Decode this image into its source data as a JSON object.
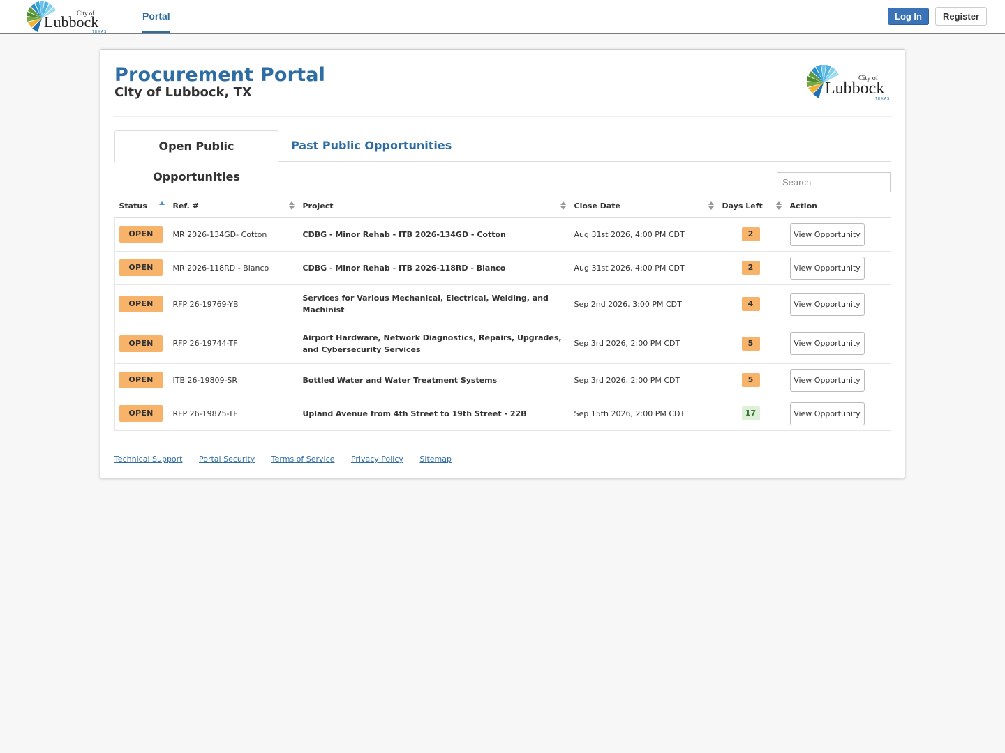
{
  "header": {
    "logo": {
      "city_of": "City of",
      "name": "Lubbock",
      "state": "TEXAS"
    },
    "nav_portal": "Portal",
    "login_label": "Log In",
    "register_label": "Register"
  },
  "page": {
    "title": "Procurement Portal",
    "subtitle": "City of Lubbock, TX"
  },
  "tabs": [
    {
      "label": "Open Public Opportunities",
      "active": true
    },
    {
      "label": "Past Public Opportunities",
      "active": false
    }
  ],
  "search": {
    "placeholder": "Search",
    "value": ""
  },
  "table": {
    "columns": [
      "Status",
      "Ref. #",
      "Project",
      "Close Date",
      "Days Left",
      "Action"
    ],
    "rows": [
      {
        "status": "OPEN",
        "ref": "MR 2026-134GD- Cotton",
        "project": "CDBG - Minor Rehab - ITB 2026-134GD - Cotton",
        "close_date": "Aug 31st 2026, 4:00 PM CDT",
        "days_left": "2",
        "action": "View Opportunity"
      },
      {
        "status": "OPEN",
        "ref": "MR 2026-118RD - Blanco",
        "project": "CDBG - Minor Rehab - ITB 2026-118RD - Blanco",
        "close_date": "Aug 31st 2026, 4:00 PM CDT",
        "days_left": "2",
        "action": "View Opportunity"
      },
      {
        "status": "OPEN",
        "ref": "RFP 26-19769-YB",
        "project": "Services for Various Mechanical, Electrical, Welding, and Machinist",
        "close_date": "Sep 2nd 2026, 3:00 PM CDT",
        "days_left": "4",
        "action": "View Opportunity"
      },
      {
        "status": "OPEN",
        "ref": "RFP 26-19744-TF",
        "project": "Airport Hardware, Network Diagnostics, Repairs, Upgrades, and Cybersecurity Services",
        "close_date": "Sep 3rd 2026, 2:00 PM CDT",
        "days_left": "5",
        "action": "View Opportunity"
      },
      {
        "status": "OPEN",
        "ref": "ITB 26-19809-SR",
        "project": "Bottled Water and Water Treatment Systems",
        "close_date": "Sep 3rd 2026, 2:00 PM CDT",
        "days_left": "5",
        "action": "View Opportunity"
      },
      {
        "status": "OPEN",
        "ref": "RFP 26-19875-TF",
        "project": "Upland Avenue from 4th Street to 19th Street - 22B",
        "close_date": "Sep 15th 2026, 2:00 PM CDT",
        "days_left": "17",
        "action": "View Opportunity"
      }
    ]
  },
  "footer": {
    "links": [
      "Technical Support",
      "Portal Security",
      "Terms of Service",
      "Privacy Policy",
      "Sitemap"
    ]
  },
  "colors": {
    "brand_blue": "#2e6da4",
    "status_open": "#f8b36b",
    "days_ok": "#dff0d8"
  }
}
